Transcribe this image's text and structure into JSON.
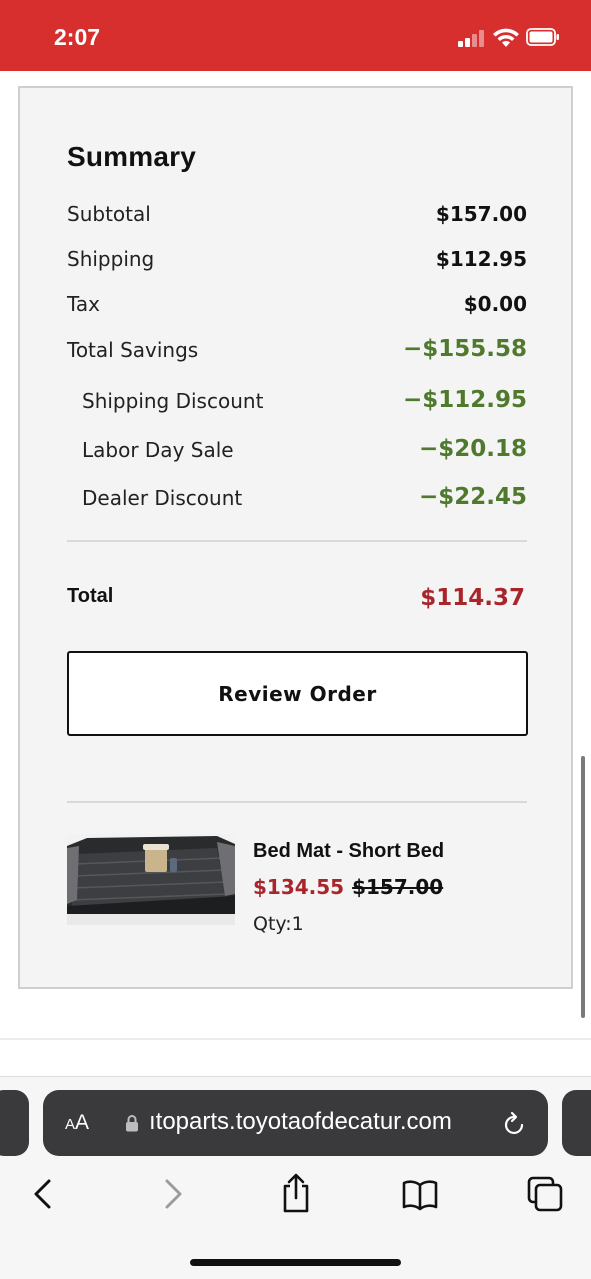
{
  "status_bar": {
    "time": "2:07"
  },
  "summary": {
    "title": "Summary",
    "rows": [
      {
        "label": "Subtotal",
        "value": "$157.00"
      },
      {
        "label": "Shipping",
        "value": "$112.95"
      },
      {
        "label": "Tax",
        "value": "$0.00"
      },
      {
        "label": "Total Savings",
        "value": "−$155.58"
      }
    ],
    "discounts": [
      {
        "label": "Shipping Discount",
        "value": "−$112.95"
      },
      {
        "label": "Labor Day Sale",
        "value": "−$20.18"
      },
      {
        "label": "Dealer Discount",
        "value": "−$22.45"
      }
    ],
    "total_label": "Total",
    "total_value": "$114.37",
    "review_button": "Review Order"
  },
  "product": {
    "name": "Bed Mat - Short Bed",
    "sale_price": "$134.55",
    "original_price": "$157.00",
    "qty": "Qty:1"
  },
  "browser": {
    "aa_label": "AA",
    "url": "ıtoparts.toyotaofdecatur.com"
  },
  "colors": {
    "status_bar": "#d72f2d",
    "savings_green": "#4f7a2e",
    "total_red": "#a8262b"
  }
}
